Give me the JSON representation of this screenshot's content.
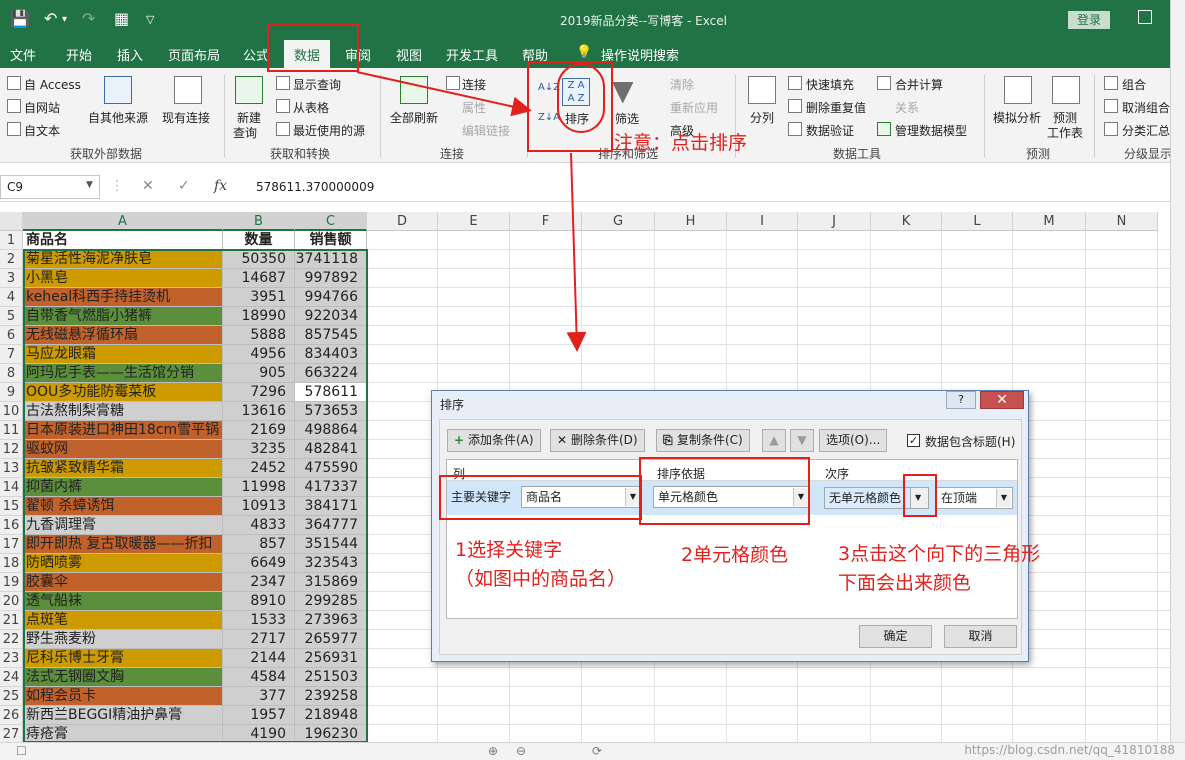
{
  "app": {
    "doc_title": "2019新品分类--写博客  -  Excel",
    "login": "登录"
  },
  "tabs": [
    "文件",
    "开始",
    "插入",
    "页面布局",
    "公式",
    "数据",
    "审阅",
    "视图",
    "开发工具",
    "帮助",
    "操作说明搜索"
  ],
  "ribbon": {
    "get_external": {
      "items": [
        "自 Access",
        "自网站",
        "自文本",
        "自其他来源",
        "现有连接"
      ],
      "group_label": "获取外部数据"
    },
    "get_transform": {
      "new_query": [
        "新建",
        "查询"
      ],
      "items": [
        "显示查询",
        "从表格",
        "最近使用的源"
      ],
      "group_label": "获取和转换"
    },
    "connections": {
      "refresh_all": "全部刷新",
      "items": [
        "连接",
        "属性",
        "编辑链接"
      ],
      "group_label": "连接"
    },
    "sort_filter": {
      "sort": "排序",
      "filter": "筛选",
      "items": [
        "清除",
        "重新应用",
        "高级"
      ],
      "group_label": "排序和筛选"
    },
    "data_tools": {
      "split": "分列",
      "items": [
        "快速填充",
        "删除重复值",
        "数据验证",
        "合并计算",
        "关系",
        "管理数据模型"
      ],
      "group_label": "数据工具"
    },
    "forecast": {
      "whatif": "模拟分析",
      "sheet": [
        "预测",
        "工作表"
      ],
      "group_label": "预测"
    },
    "outline": {
      "items": [
        "组合",
        "取消组合",
        "分类汇总"
      ],
      "group_label": "分级显示"
    }
  },
  "formula_bar": {
    "name_box": "C9",
    "value": "578611.370000009"
  },
  "sheet": {
    "columns": [
      "A",
      "B",
      "C",
      "D",
      "E",
      "F",
      "G",
      "H",
      "I",
      "J",
      "K",
      "L",
      "M",
      "N"
    ],
    "header_row": [
      "商品名",
      "数量",
      "销售额"
    ],
    "rows": [
      {
        "n": "2",
        "name": "菊星活性海泥净肤皂",
        "qty": "50350",
        "sales": "3741118",
        "color": "#cd9a00"
      },
      {
        "n": "3",
        "name": "小黑皂",
        "qty": "14687",
        "sales": "997892",
        "color": "#cd9a00"
      },
      {
        "n": "4",
        "name": "keheal科西手持挂烫机",
        "qty": "3951",
        "sales": "994766",
        "color": "#c1622c"
      },
      {
        "n": "5",
        "name": "自带香气燃脂小猪裤",
        "qty": "18990",
        "sales": "922034",
        "color": "#5b8f3c"
      },
      {
        "n": "6",
        "name": "无线磁悬浮循环扇",
        "qty": "5888",
        "sales": "857545",
        "color": "#c1622c"
      },
      {
        "n": "7",
        "name": "马应龙眼霜",
        "qty": "4956",
        "sales": "834403",
        "color": "#cd9a00"
      },
      {
        "n": "8",
        "name": "阿玛尼手表——生活馆分销",
        "qty": "905",
        "sales": "663224",
        "color": "#5b8f3c"
      },
      {
        "n": "9",
        "name": "OOU多功能防霉菜板",
        "qty": "7296",
        "sales": "578611",
        "color": "#cd9a00"
      },
      {
        "n": "10",
        "name": "古法熬制梨膏糖",
        "qty": "13616",
        "sales": "573653",
        "color": "#cfcfcf"
      },
      {
        "n": "11",
        "name": "日本原装进口神田18cm雪平锅",
        "qty": "2169",
        "sales": "498864",
        "color": "#c1622c"
      },
      {
        "n": "12",
        "name": "驱蚊网",
        "qty": "3235",
        "sales": "482841",
        "color": "#c1622c"
      },
      {
        "n": "13",
        "name": "抗皱紧致精华霜",
        "qty": "2452",
        "sales": "475590",
        "color": "#cd9a00"
      },
      {
        "n": "14",
        "name": "抑菌内裤",
        "qty": "11998",
        "sales": "417337",
        "color": "#5b8f3c"
      },
      {
        "n": "15",
        "name": "翟顿 杀蟑诱饵",
        "qty": "10913",
        "sales": "384171",
        "color": "#c1622c"
      },
      {
        "n": "16",
        "name": "九香调理膏",
        "qty": "4833",
        "sales": "364777",
        "color": "#cfcfcf"
      },
      {
        "n": "17",
        "name": "即开即热 复古取暖器——折扣",
        "qty": "857",
        "sales": "351544",
        "color": "#c1622c"
      },
      {
        "n": "18",
        "name": "防晒喷雾",
        "qty": "6649",
        "sales": "323543",
        "color": "#cd9a00"
      },
      {
        "n": "19",
        "name": "胶囊伞",
        "qty": "2347",
        "sales": "315869",
        "color": "#c1622c"
      },
      {
        "n": "20",
        "name": "透气船袜",
        "qty": "8910",
        "sales": "299285",
        "color": "#5b8f3c"
      },
      {
        "n": "21",
        "name": "点斑笔",
        "qty": "1533",
        "sales": "273963",
        "color": "#cd9a00"
      },
      {
        "n": "22",
        "name": "野生燕麦粉",
        "qty": "2717",
        "sales": "265977",
        "color": "#cfcfcf"
      },
      {
        "n": "23",
        "name": "尼科乐博士牙膏",
        "qty": "2144",
        "sales": "256931",
        "color": "#cd9a00"
      },
      {
        "n": "24",
        "name": "法式无钢圈文胸",
        "qty": "4584",
        "sales": "251503",
        "color": "#5b8f3c"
      },
      {
        "n": "25",
        "name": "如程会员卡",
        "qty": "377",
        "sales": "239258",
        "color": "#c1622c"
      },
      {
        "n": "26",
        "name": "新西兰BEGGI精油护鼻膏",
        "qty": "1957",
        "sales": "218948",
        "color": "#cfcfcf"
      },
      {
        "n": "27",
        "name": "痔疮膏",
        "qty": "4190",
        "sales": "196230",
        "color": "#cfcfcf"
      }
    ]
  },
  "dialog": {
    "title": "排序",
    "help": "?",
    "close": "✕",
    "add_level": "添加条件(A)",
    "delete_level": "删除条件(D)",
    "copy_level": "复制条件(C)",
    "options": "选项(O)...",
    "has_headers": "数据包含标题(H)",
    "col_header": "列",
    "sort_on_header": "排序依据",
    "order_header": "次序",
    "row_label": "主要关键字",
    "column_value": "商品名",
    "sort_on_value": "单元格颜色",
    "order_value": "无单元格颜色",
    "position_value": "在顶端",
    "ok": "确定",
    "cancel": "取消"
  },
  "annotations": {
    "note_sort": "注意：点击排序",
    "step1_line1": "1选择关键字",
    "step1_line2": "（如图中的商品名）",
    "step2": "2单元格颜色",
    "step3_line1": "3点击这个向下的三角形",
    "step3_line2": "下面会出来颜色",
    "arrow_color": "#e0221d"
  },
  "watermark": "https://blog.csdn.net/qq_41810188",
  "colors": {
    "excel_green": "#217346",
    "annotation_red": "#e0221d"
  }
}
